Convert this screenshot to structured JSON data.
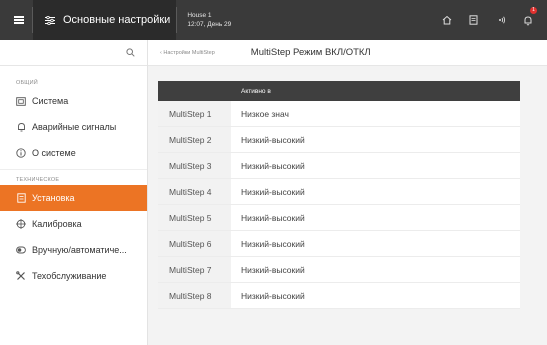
{
  "topbar": {
    "title": "Основные настройки",
    "house_name": "House 1",
    "house_time": "12:07, День 29",
    "notification_count": "1",
    "colors": {
      "bar": "#3a3a3a",
      "accent": "#ec7424",
      "badge": "#e0312f"
    },
    "icons": [
      "menu-icon",
      "sliders-icon",
      "home-icon",
      "document-icon",
      "broadcast-icon",
      "bell-icon"
    ]
  },
  "sidebar": {
    "section_general": "ОБЩИЙ",
    "section_technical": "ТЕХНИЧЕСКОЕ",
    "items": [
      {
        "label": "Система",
        "icon": "system-icon"
      },
      {
        "label": "Аварийные сигналы",
        "icon": "alarm-bell-icon"
      },
      {
        "label": "О системе",
        "icon": "info-icon"
      },
      {
        "label": "Установка",
        "icon": "installation-icon"
      },
      {
        "label": "Калибровка",
        "icon": "calibration-icon"
      },
      {
        "label": "Вручную/автоматиче...",
        "icon": "manual-auto-icon"
      },
      {
        "label": "Техобслуживание",
        "icon": "wrench-icon"
      }
    ]
  },
  "breadcrumb": {
    "parent": "‹ Настройки MultiStep",
    "title": "MultiStep Режим ВКЛ/ОТКЛ"
  },
  "table": {
    "header": "Активно в",
    "rows": [
      {
        "name": "MultiStep 1",
        "value": "Низкое знач"
      },
      {
        "name": "MultiStep 2",
        "value": "Низкий-высокий"
      },
      {
        "name": "MultiStep 3",
        "value": "Низкий-высокий"
      },
      {
        "name": "MultiStep 4",
        "value": "Низкий-высокий"
      },
      {
        "name": "MultiStep 5",
        "value": "Низкий-высокий"
      },
      {
        "name": "MultiStep 6",
        "value": "Низкий-высокий"
      },
      {
        "name": "MultiStep 7",
        "value": "Низкий-высокий"
      },
      {
        "name": "MultiStep 8",
        "value": "Низкий-высокий"
      }
    ]
  }
}
